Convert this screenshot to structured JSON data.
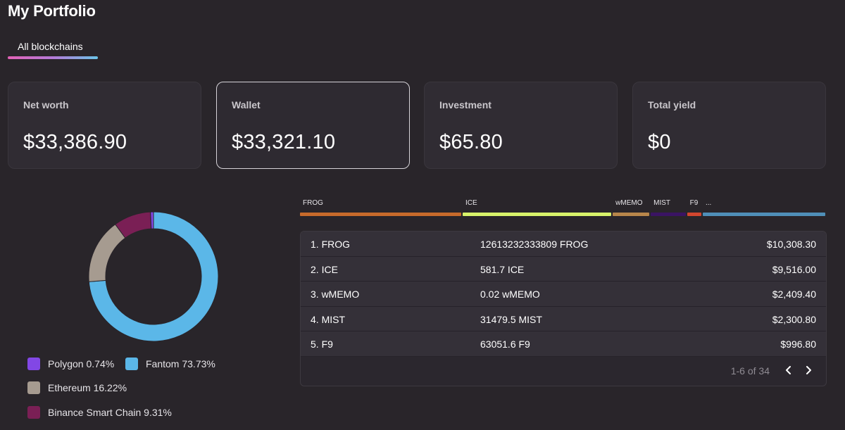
{
  "header": {
    "title": "My Portfolio"
  },
  "tabs": [
    {
      "label": "All blockchains",
      "active": true
    }
  ],
  "cards": [
    {
      "label": "Net worth",
      "value": "$33,386.90"
    },
    {
      "label": "Wallet",
      "value": "$33,321.10"
    },
    {
      "label": "Investment",
      "value": "$65.80"
    },
    {
      "label": "Total yield",
      "value": "$0"
    }
  ],
  "chain_chart": {
    "type": "pie",
    "slices": [
      {
        "label": "Fantom 73.73%",
        "value": 73.73,
        "color": "#5bb7e8"
      },
      {
        "label": "Ethereum 16.22%",
        "value": 16.22,
        "color": "#a69b90"
      },
      {
        "label": "Binance Smart Chain 9.31%",
        "value": 9.31,
        "color": "#7a1f55"
      },
      {
        "label": "Polygon 0.74%",
        "value": 0.74,
        "color": "#8247e5"
      }
    ]
  },
  "token_bar": {
    "segments": [
      {
        "label": "FROG",
        "value": 10308.3,
        "color": "#c76a2b"
      },
      {
        "label": "ICE",
        "value": 9516.0,
        "color": "#d8f26a"
      },
      {
        "label": "wMEMO",
        "value": 2409.4,
        "color": "#b8864a"
      },
      {
        "label": "MIST",
        "value": 2300.8,
        "color": "#3a1463"
      },
      {
        "label": "F9",
        "value": 996.8,
        "color": "#d2462f"
      },
      {
        "label": "...",
        "value": 7855.6,
        "color": "#4f8fb8"
      }
    ]
  },
  "holdings": {
    "rows": [
      {
        "name": "1. FROG",
        "amount": "12613232333809 FROG",
        "value": "$10,308.30"
      },
      {
        "name": "2. ICE",
        "amount": "581.7 ICE",
        "value": "$9,516.00"
      },
      {
        "name": "3. wMEMO",
        "amount": "0.02 wMEMO",
        "value": "$2,409.40"
      },
      {
        "name": "4. MIST",
        "amount": "31479.5 MIST",
        "value": "$2,300.80"
      },
      {
        "name": "5. F9",
        "amount": "63051.6 F9",
        "value": "$996.80"
      }
    ],
    "pagination": {
      "text": "1-6 of 34"
    }
  }
}
